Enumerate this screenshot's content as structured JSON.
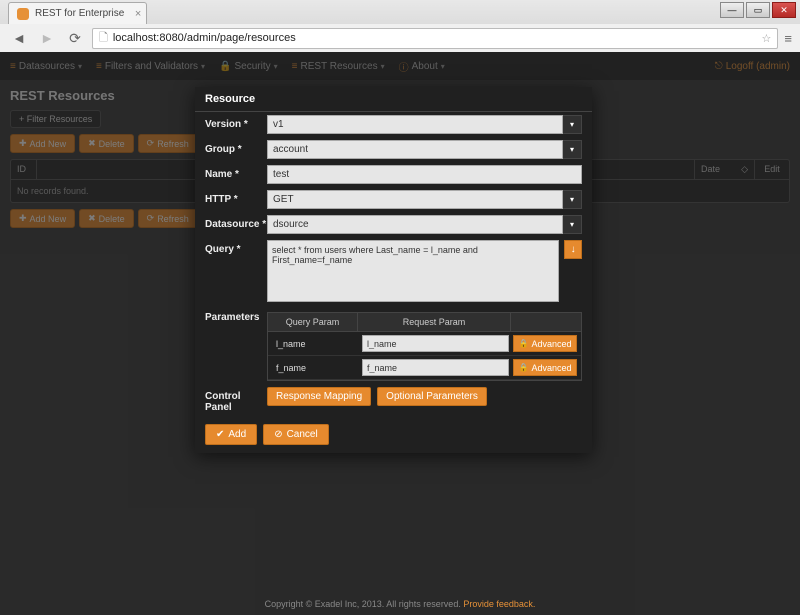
{
  "browser": {
    "tab_title": "REST for Enterprise",
    "url_display": "localhost:8080/admin/page/resources",
    "window_buttons": {
      "min": "—",
      "max": "▭",
      "close": "✕"
    }
  },
  "navbar": {
    "items": [
      {
        "icon": "≡",
        "label": "Datasources"
      },
      {
        "icon": "≡",
        "label": "Filters and Validators"
      },
      {
        "icon": "🔒",
        "label": "Security"
      },
      {
        "icon": "≡",
        "label": "REST Resources"
      },
      {
        "icon": "ⓘ",
        "label": "About"
      }
    ],
    "logoff_label": "Logoff (admin)"
  },
  "page": {
    "title": "REST Resources",
    "filter_button": "+ Filter Resources",
    "toolbar": {
      "add": "Add New",
      "delete": "Delete",
      "refresh": "Refresh"
    },
    "table": {
      "cols": {
        "id": "ID",
        "date": "Date",
        "edit": "Edit"
      },
      "no_records": "No records found."
    }
  },
  "modal": {
    "title": "Resource",
    "labels": {
      "version": "Version *",
      "group": "Group *",
      "name": "Name *",
      "http": "HTTP *",
      "datasource": "Datasource *",
      "query": "Query *",
      "parameters": "Parameters",
      "control_panel": "Control Panel"
    },
    "values": {
      "version": "v1",
      "group": "account",
      "name": "test",
      "http": "GET",
      "datasource": "dsource",
      "query": "select * from users where Last_name = l_name and First_name=f_name"
    },
    "param_headers": {
      "query": "Query Param",
      "request": "Request Param"
    },
    "params": [
      {
        "qname": "l_name",
        "rname": "l_name",
        "adv": "Advanced"
      },
      {
        "qname": "f_name",
        "rname": "f_name",
        "adv": "Advanced"
      }
    ],
    "control_buttons": {
      "mapping": "Response Mapping",
      "optional": "Optional Parameters"
    },
    "footer": {
      "add": "Add",
      "cancel": "Cancel"
    }
  },
  "footer": {
    "copyright": "Copyright © Exadel Inc, 2013. All rights reserved.",
    "feedback": "Provide feedback."
  }
}
